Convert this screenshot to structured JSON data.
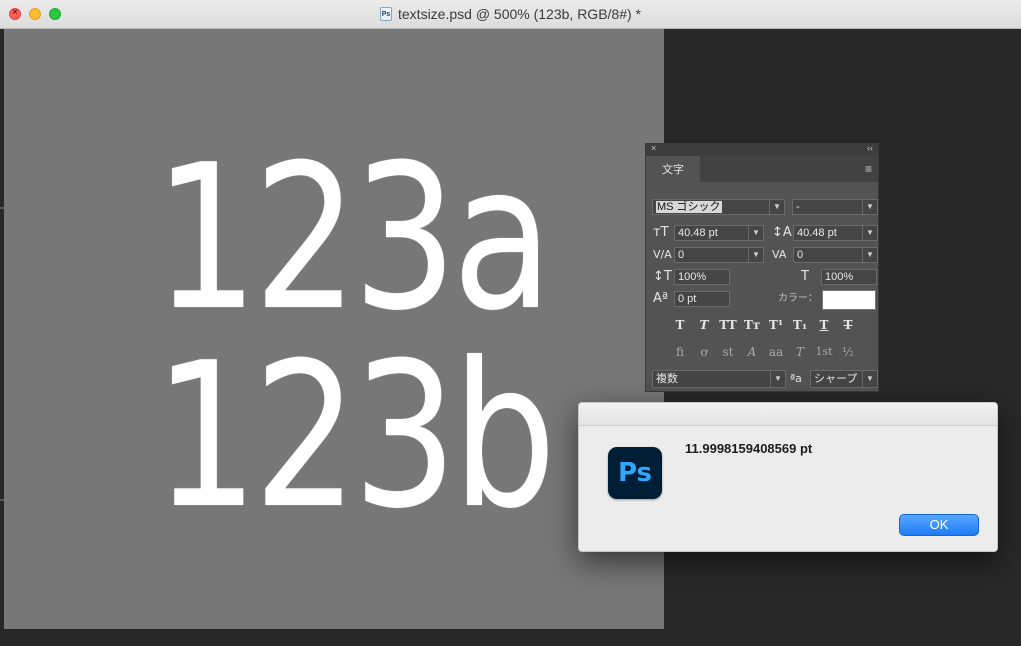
{
  "window": {
    "title": "textsize.psd @ 500% (123b, RGB/8#) *",
    "file_icon_label": "Ps",
    "close_glyph": "×"
  },
  "canvas": {
    "lines": [
      "123a",
      "123b"
    ]
  },
  "character_panel": {
    "tab_label": "文字",
    "close_glyph": "×",
    "collapse_glyph": "‹‹",
    "menu_glyph": "≡",
    "font_family": "MS ゴシック",
    "font_style": "-",
    "font_size": "40.48 pt",
    "leading": "40.48 pt",
    "kerning": "0",
    "tracking": "0",
    "vertical_scale": "100%",
    "horizontal_scale": "100%",
    "baseline_shift": "0 pt",
    "color_label": "カラー：",
    "color_value": "#ffffff",
    "language": "複数",
    "antialias_icon_label": "ªa",
    "antialias": "シャープ",
    "style_buttons": [
      "T",
      "T",
      "TT",
      "Tт",
      "T¹",
      "T₁",
      "T",
      "T"
    ],
    "opentype_buttons": [
      "ﬁ",
      "ơ",
      "st",
      "A",
      "aa",
      "T",
      "1st",
      "½"
    ],
    "icons": {
      "size": "font-size-icon",
      "leading": "leading-icon",
      "kerning": "kerning-icon",
      "tracking": "tracking-icon",
      "vscale": "vertical-scale-icon",
      "hscale": "horizontal-scale-icon",
      "baseline": "baseline-shift-icon"
    }
  },
  "dialog": {
    "message": "11.9998159408569 pt",
    "ok_label": "OK",
    "app_icon_label": "Ps"
  },
  "colors": {
    "canvas_bg": "#777777",
    "workspace_bg": "#282828",
    "panel_bg": "#535353",
    "ok_button": "#1f7cf5",
    "ps_icon_bg": "#001e36",
    "ps_icon_fg": "#31a8ff"
  }
}
